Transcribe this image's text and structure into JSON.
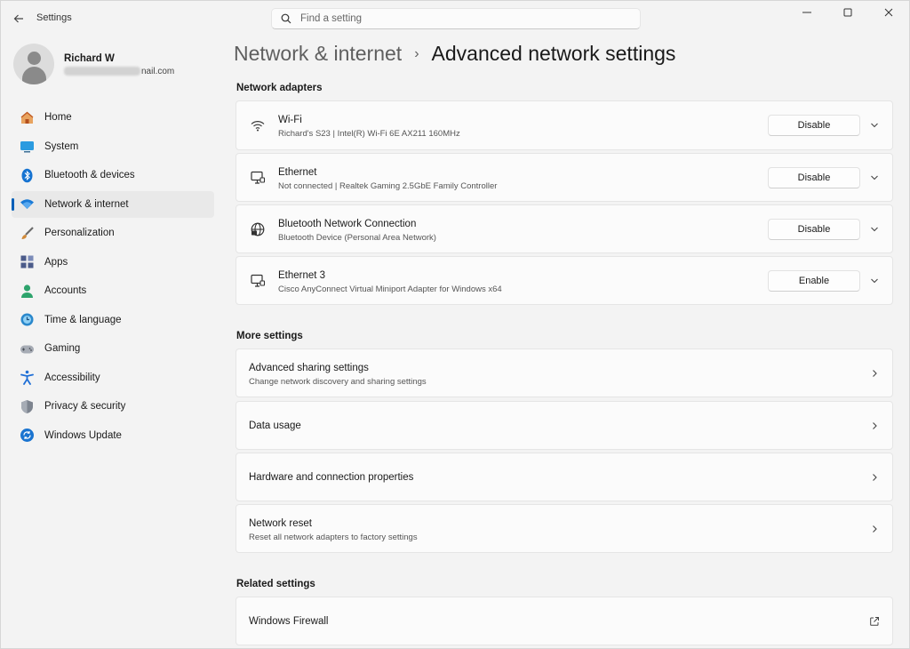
{
  "window": {
    "title": "Settings",
    "search_placeholder": "Find a setting"
  },
  "user": {
    "name": "Richard W",
    "email_visible": "nail.com"
  },
  "sidebar": {
    "items": [
      {
        "label": "Home",
        "icon": "home-icon",
        "color": "#c9642b"
      },
      {
        "label": "System",
        "icon": "system-icon",
        "color": "#1b8ad0"
      },
      {
        "label": "Bluetooth & devices",
        "icon": "bluetooth-icon",
        "color": "#1673d1"
      },
      {
        "label": "Network & internet",
        "icon": "wifi-icon",
        "color": "#1a7ad6",
        "active": true
      },
      {
        "label": "Personalization",
        "icon": "brush-icon",
        "color": "#d08a3a"
      },
      {
        "label": "Apps",
        "icon": "apps-icon",
        "color": "#4b5b8a"
      },
      {
        "label": "Accounts",
        "icon": "accounts-icon",
        "color": "#2da36c"
      },
      {
        "label": "Time & language",
        "icon": "time-language-icon",
        "color": "#2a88cc"
      },
      {
        "label": "Gaming",
        "icon": "gaming-icon",
        "color": "#8a8f99"
      },
      {
        "label": "Accessibility",
        "icon": "accessibility-icon",
        "color": "#1f6fd6"
      },
      {
        "label": "Privacy & security",
        "icon": "shield-icon",
        "color": "#6d7480"
      },
      {
        "label": "Windows Update",
        "icon": "update-icon",
        "color": "#1a74d0"
      }
    ]
  },
  "breadcrumb": {
    "parent": "Network & internet",
    "separator": "›",
    "current": "Advanced network settings"
  },
  "sections": {
    "adapters_title": "Network adapters",
    "more_title": "More settings",
    "related_title": "Related settings"
  },
  "adapters": [
    {
      "name": "Wi-Fi",
      "detail": "Richard's S23 | Intel(R) Wi-Fi 6E AX211 160MHz",
      "button": "Disable",
      "icon": "wifi-adapter-icon"
    },
    {
      "name": "Ethernet",
      "detail": "Not connected | Realtek Gaming 2.5GbE Family Controller",
      "button": "Disable",
      "icon": "ethernet-adapter-icon"
    },
    {
      "name": "Bluetooth Network Connection",
      "detail": "Bluetooth Device (Personal Area Network)",
      "button": "Disable",
      "icon": "globe-adapter-icon"
    },
    {
      "name": "Ethernet 3",
      "detail": "Cisco AnyConnect Virtual Miniport Adapter for Windows x64",
      "button": "Enable",
      "icon": "ethernet-adapter-icon"
    }
  ],
  "more_settings": [
    {
      "title": "Advanced sharing settings",
      "sub": "Change network discovery and sharing settings"
    },
    {
      "title": "Data usage",
      "sub": ""
    },
    {
      "title": "Hardware and connection properties",
      "sub": ""
    },
    {
      "title": "Network reset",
      "sub": "Reset all network adapters to factory settings"
    }
  ],
  "related_settings": [
    {
      "title": "Windows Firewall",
      "icon": "external-link-icon"
    }
  ]
}
